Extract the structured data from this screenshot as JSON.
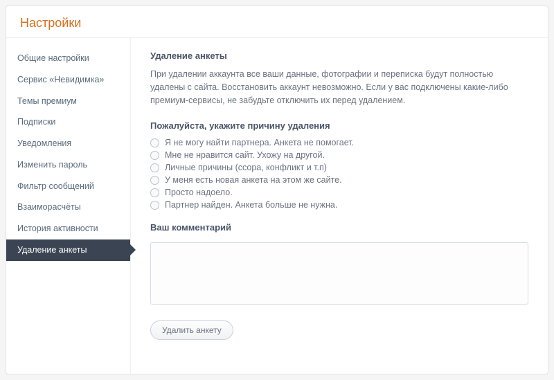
{
  "header": {
    "title": "Настройки"
  },
  "sidebar": {
    "items": [
      {
        "label": "Общие настройки",
        "active": false
      },
      {
        "label": "Сервис «Невидимка»",
        "active": false
      },
      {
        "label": "Темы премиум",
        "active": false
      },
      {
        "label": "Подписки",
        "active": false
      },
      {
        "label": "Уведомления",
        "active": false
      },
      {
        "label": "Изменить пароль",
        "active": false
      },
      {
        "label": "Фильтр сообщений",
        "active": false
      },
      {
        "label": "Взаиморасчёты",
        "active": false
      },
      {
        "label": "История активности",
        "active": false
      },
      {
        "label": "Удаление анкеты",
        "active": true
      }
    ]
  },
  "content": {
    "heading": "Удаление анкеты",
    "description": "При удалении аккаунта все ваши данные, фотографии и переписка будут полностью удалены с сайта. Восстановить аккаунт невозможно. Если у вас подключены какие-либо премиум-сервисы, не забудьте отключить их перед удалением.",
    "reason_heading": "Пожалуйста, укажите причину удаления",
    "reasons": [
      "Я не могу найти партнера. Анкета не помогает.",
      "Мне не нравится сайт. Ухожу на другой.",
      "Личные причины (ссора, конфликт и т.п)",
      "У меня есть новая анкета на этом же сайте.",
      "Просто надоело.",
      "Партнер найден. Анкета больше не нужна."
    ],
    "comment_label": "Ваш комментарий",
    "submit_label": "Удалить анкету"
  }
}
